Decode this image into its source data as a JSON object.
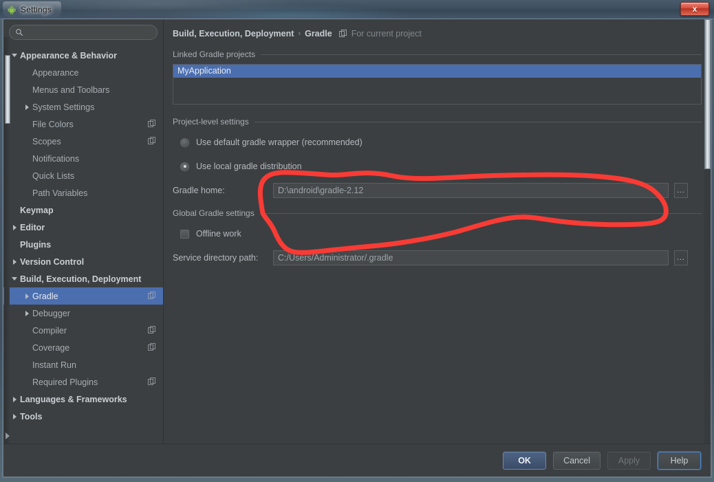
{
  "window": {
    "title": "Settings",
    "app_icon": "android-droid-icon",
    "close_label": "x"
  },
  "search": {
    "value": "",
    "placeholder": "",
    "icon": "search-icon"
  },
  "sidebar": {
    "items": [
      {
        "label": "Appearance & Behavior",
        "indent": 0,
        "twisty": "down",
        "bold": true,
        "selected": false,
        "badge": false
      },
      {
        "label": "Appearance",
        "indent": 1,
        "twisty": "none",
        "bold": false,
        "selected": false,
        "badge": false
      },
      {
        "label": "Menus and Toolbars",
        "indent": 1,
        "twisty": "none",
        "bold": false,
        "selected": false,
        "badge": false
      },
      {
        "label": "System Settings",
        "indent": 1,
        "twisty": "right",
        "bold": false,
        "selected": false,
        "badge": false
      },
      {
        "label": "File Colors",
        "indent": 1,
        "twisty": "none",
        "bold": false,
        "selected": false,
        "badge": true
      },
      {
        "label": "Scopes",
        "indent": 1,
        "twisty": "none",
        "bold": false,
        "selected": false,
        "badge": true
      },
      {
        "label": "Notifications",
        "indent": 1,
        "twisty": "none",
        "bold": false,
        "selected": false,
        "badge": false
      },
      {
        "label": "Quick Lists",
        "indent": 1,
        "twisty": "none",
        "bold": false,
        "selected": false,
        "badge": false
      },
      {
        "label": "Path Variables",
        "indent": 1,
        "twisty": "none",
        "bold": false,
        "selected": false,
        "badge": false
      },
      {
        "label": "Keymap",
        "indent": 0,
        "twisty": "none",
        "bold": true,
        "selected": false,
        "badge": false
      },
      {
        "label": "Editor",
        "indent": 0,
        "twisty": "right",
        "bold": true,
        "selected": false,
        "badge": false
      },
      {
        "label": "Plugins",
        "indent": 0,
        "twisty": "none",
        "bold": true,
        "selected": false,
        "badge": false
      },
      {
        "label": "Version Control",
        "indent": 0,
        "twisty": "right",
        "bold": true,
        "selected": false,
        "badge": false
      },
      {
        "label": "Build, Execution, Deployment",
        "indent": 0,
        "twisty": "down",
        "bold": true,
        "selected": false,
        "badge": false
      },
      {
        "label": "Gradle",
        "indent": 1,
        "twisty": "right",
        "bold": false,
        "selected": true,
        "badge": true
      },
      {
        "label": "Debugger",
        "indent": 1,
        "twisty": "right",
        "bold": false,
        "selected": false,
        "badge": false
      },
      {
        "label": "Compiler",
        "indent": 1,
        "twisty": "none",
        "bold": false,
        "selected": false,
        "badge": true
      },
      {
        "label": "Coverage",
        "indent": 1,
        "twisty": "none",
        "bold": false,
        "selected": false,
        "badge": true
      },
      {
        "label": "Instant Run",
        "indent": 1,
        "twisty": "none",
        "bold": false,
        "selected": false,
        "badge": false
      },
      {
        "label": "Required Plugins",
        "indent": 1,
        "twisty": "none",
        "bold": false,
        "selected": false,
        "badge": true
      },
      {
        "label": "Languages & Frameworks",
        "indent": 0,
        "twisty": "right",
        "bold": true,
        "selected": false,
        "badge": false
      },
      {
        "label": "Tools",
        "indent": 0,
        "twisty": "right",
        "bold": true,
        "selected": false,
        "badge": false
      }
    ]
  },
  "breadcrumb": {
    "root": "Build, Execution, Deployment",
    "separator": "›",
    "leaf": "Gradle",
    "scope_icon": "project-scope-icon",
    "scope_note": "For current project"
  },
  "main": {
    "linked_projects": {
      "group_title": "Linked Gradle projects",
      "rows": [
        "MyApplication"
      ],
      "selected_index": 0
    },
    "project_level": {
      "group_title": "Project-level settings",
      "radio_wrapper": {
        "label": "Use default gradle wrapper (recommended)",
        "selected": false
      },
      "radio_local": {
        "label": "Use local gradle distribution",
        "selected": true
      },
      "gradle_home": {
        "label": "Gradle home:",
        "value": "D:\\android\\gradle-2.12",
        "browse_label": "…"
      }
    },
    "global_settings": {
      "group_title": "Global Gradle settings",
      "offline_work": {
        "label": "Offline work",
        "checked": false
      },
      "service_dir": {
        "label": "Service directory path:",
        "value": "C:/Users/Administrator/.gradle",
        "browse_label": "…"
      }
    }
  },
  "footer": {
    "ok": "OK",
    "cancel": "Cancel",
    "apply": "Apply",
    "help": "Help"
  },
  "annotation": {
    "type": "freehand-red-ellipse",
    "color": "#f93b35",
    "stroke_width": 7
  },
  "colors": {
    "accent_selection": "#4b6eaf",
    "panel_bg": "#3c3f41",
    "annotation_red": "#f93b35",
    "default_button": "#3b4c67"
  }
}
